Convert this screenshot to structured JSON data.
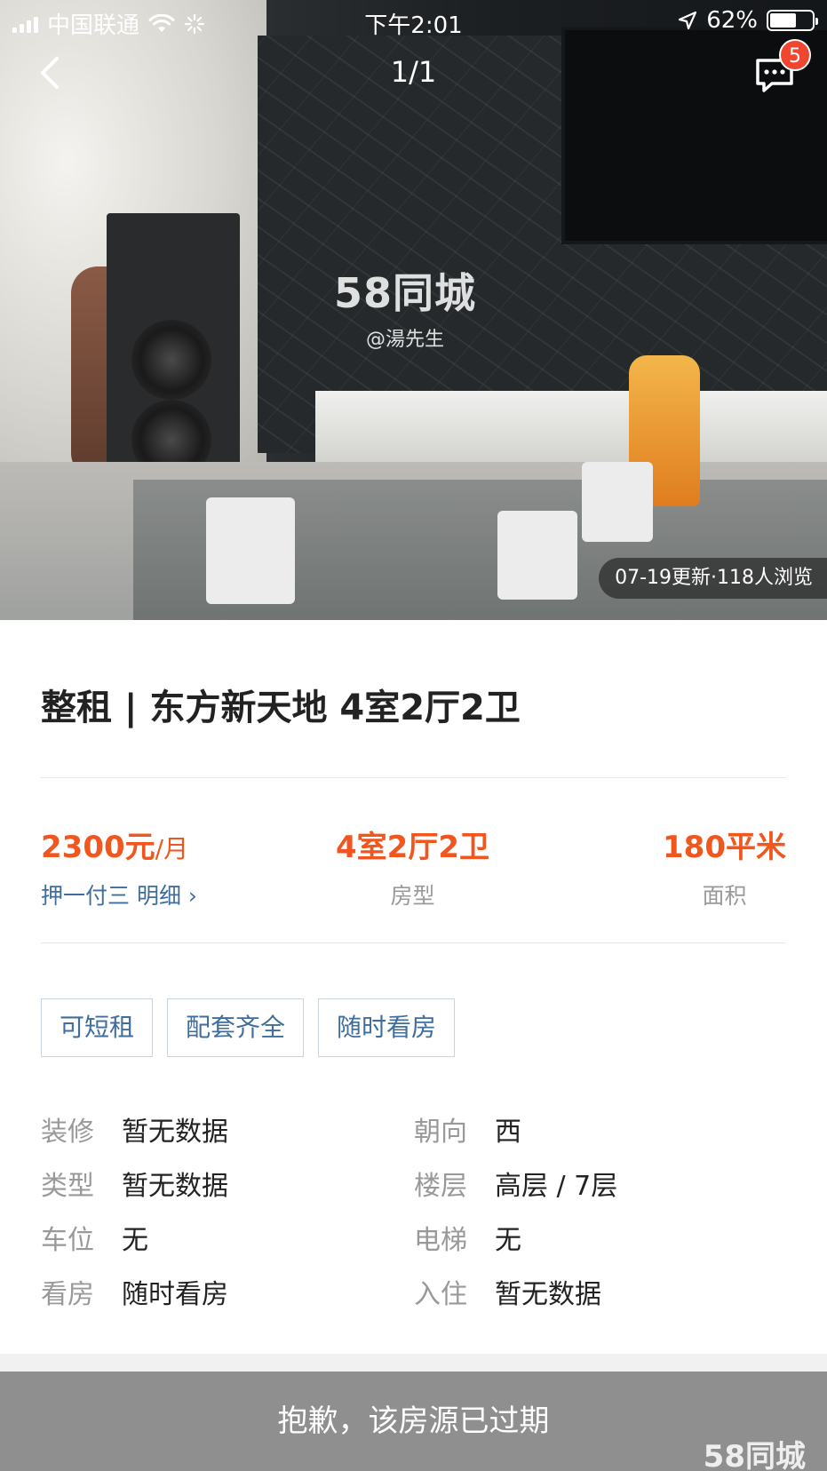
{
  "status_bar": {
    "carrier": "中国联通",
    "time": "下午2:01",
    "battery": "62%",
    "battery_level": 0.62
  },
  "nav": {
    "page_counter": "1/1",
    "message_badge": "5"
  },
  "photo": {
    "watermark_brand": "58同城",
    "watermark_user": "@湯先生",
    "update_info": "07-19更新·118人浏览"
  },
  "listing": {
    "title": "整租 | 东方新天地 4室2厅2卫",
    "price_value": "2300元",
    "price_unit": "/月",
    "deposit": "押一付三 明细",
    "layout_value": "4室2厅2卫",
    "layout_label": "房型",
    "area_value": "180平米",
    "area_label": "面积"
  },
  "tags": [
    "可短租",
    "配套齐全",
    "随时看房"
  ],
  "attributes": [
    [
      {
        "key": "装修",
        "value": "暂无数据"
      },
      {
        "key": "朝向",
        "value": "西"
      }
    ],
    [
      {
        "key": "类型",
        "value": "暂无数据"
      },
      {
        "key": "楼层",
        "value": "高层 / 7层"
      }
    ],
    [
      {
        "key": "车位",
        "value": "无"
      },
      {
        "key": "电梯",
        "value": "无"
      }
    ],
    [
      {
        "key": "看房",
        "value": "随时看房"
      },
      {
        "key": "入住",
        "value": "暂无数据"
      }
    ]
  ],
  "footer": {
    "expired_text": "抱歉，该房源已过期",
    "logo": "58同城"
  },
  "colors": {
    "accent_orange": "#f0561e",
    "link_blue": "#3f6d9e",
    "badge_red": "#f0462f",
    "expired_bar": "#8f8f8f"
  }
}
